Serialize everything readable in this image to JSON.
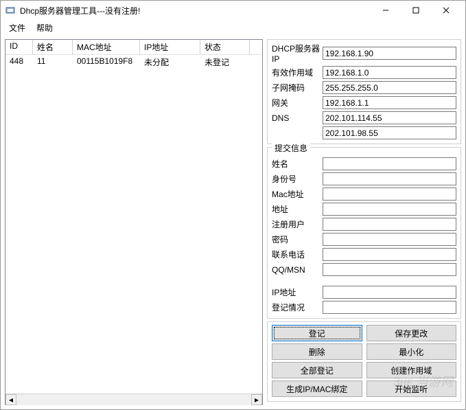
{
  "window": {
    "title": "Dhcp服务器管理工具---没有注册!"
  },
  "menu": {
    "file": "文件",
    "help": "帮助"
  },
  "table": {
    "headers": [
      "ID",
      "姓名",
      "MAC地址",
      "IP地址",
      "状态"
    ],
    "rows": [
      {
        "id": "448",
        "name": "11",
        "mac": "00115B1019F8",
        "ip": "未分配",
        "status": "未登记"
      }
    ]
  },
  "server": {
    "labels": {
      "dhcp": "DHCP服务器IP",
      "scope": "有效作用域",
      "mask": "子网掩码",
      "gateway": "网关",
      "dns": "DNS"
    },
    "dhcp": "192.168.1.90",
    "scope": "192.168.1.0",
    "mask": "255.255.255.0",
    "gateway": "192.168.1.1",
    "dns1": "202.101.114.55",
    "dns2": "202.101.98.55"
  },
  "submit": {
    "legend": "提交信息",
    "labels": {
      "name": "姓名",
      "idno": "身份号",
      "mac": "Mac地址",
      "addr": "地址",
      "reguser": "注册用户",
      "pwd": "密码",
      "phone": "联系电话",
      "qq": "QQ/MSN",
      "ip": "IP地址",
      "reg": "登记情况"
    }
  },
  "buttons": {
    "register": "登记",
    "save": "保存更改",
    "delete": "删除",
    "minimize": "最小化",
    "regall": "全部登记",
    "createscope": "创建作用域",
    "genbind": "生成IP/MAC绑定",
    "listen": "开始监听"
  },
  "watermark": "3ʜᴇ 当游网"
}
